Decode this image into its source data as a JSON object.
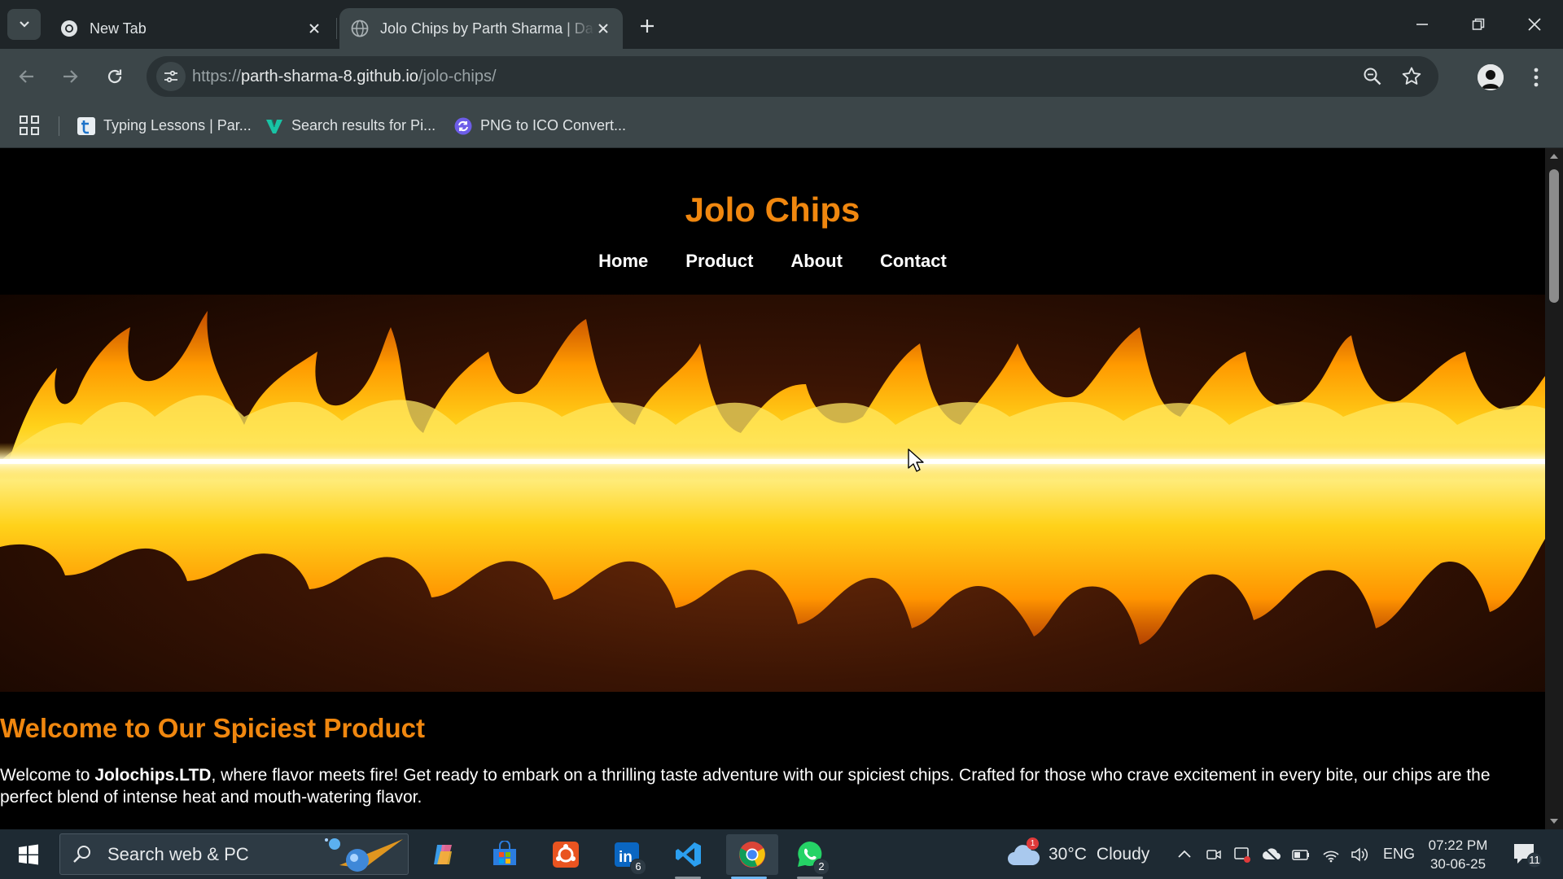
{
  "browser": {
    "tabs": [
      {
        "title": "New Tab",
        "active": false
      },
      {
        "title": "Jolo Chips by Parth Sharma | Da",
        "active": true
      }
    ],
    "url_scheme": "https://",
    "url_host": "parth-sharma-8.github.io",
    "url_path": "/jolo-chips/",
    "bookmarks": [
      {
        "label": "Typing Lessons | Par...",
        "icon": "typing-t-icon"
      },
      {
        "label": "Search results for Pi...",
        "icon": "v-logo-icon"
      },
      {
        "label": "PNG to ICO Convert...",
        "icon": "converter-icon"
      }
    ]
  },
  "page": {
    "site_title": "Jolo Chips",
    "nav": [
      "Home",
      "Product",
      "About",
      "Contact"
    ],
    "hero_alt": "fire banner",
    "welcome_heading": "Welcome to Our Spiciest Product",
    "intro_prefix": "Welcome to ",
    "intro_brand": "Jolochips.LTD",
    "intro_rest": ", where flavor meets fire! Get ready to embark on a thrilling taste adventure with our spiciest chips. Crafted for those who crave excitement in every bite, our chips are the perfect blend of intense heat and mouth-watering flavor.",
    "accent_color": "#f0870f"
  },
  "taskbar": {
    "search_placeholder": "Search web & PC",
    "apps": [
      {
        "name": "copilot",
        "badge": ""
      },
      {
        "name": "microsoft-store",
        "badge": ""
      },
      {
        "name": "ubuntu",
        "badge": ""
      },
      {
        "name": "linkedin",
        "badge": "6"
      },
      {
        "name": "vscode",
        "badge": ""
      },
      {
        "name": "chrome",
        "badge": ""
      },
      {
        "name": "whatsapp",
        "badge": "2"
      }
    ],
    "weather_temp": "30°C",
    "weather_text": "Cloudy",
    "weather_alert": "1",
    "language": "ENG",
    "time": "07:22 PM",
    "date": "30-06-25",
    "notifications": "11"
  }
}
